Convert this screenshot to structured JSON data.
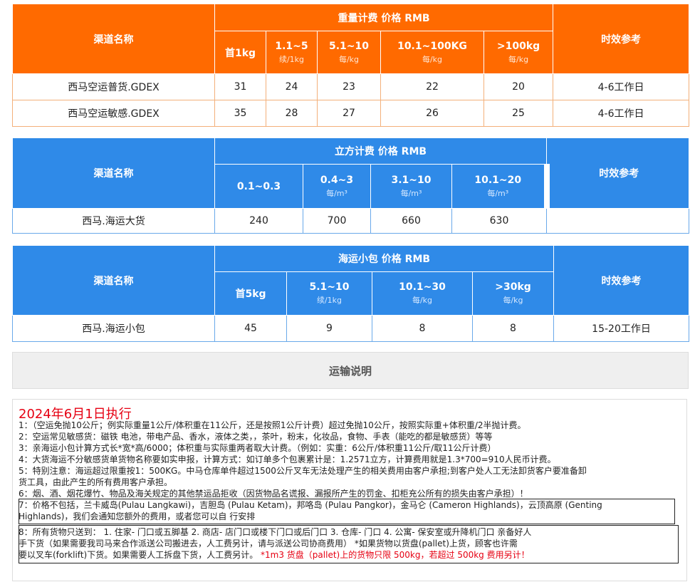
{
  "air": {
    "col_channel": "渠道名称",
    "group_title": "重量计费 价格 RMB",
    "col_time": "时效参考",
    "cols": [
      {
        "label": "首1kg",
        "sub": ""
      },
      {
        "label": "1.1~5",
        "sub": "续/1kg"
      },
      {
        "label": "5.1~10",
        "sub": "每/kg"
      },
      {
        "label": "10.1~100KG",
        "sub": "每/kg"
      },
      {
        "label": ">100kg",
        "sub": "每/kg"
      }
    ],
    "rows": [
      {
        "name": "西马空运普货.GDEX",
        "values": [
          "31",
          "24",
          "23",
          "22",
          "20"
        ],
        "time": "4-6工作日"
      },
      {
        "name": "西马空运敏感.GDEX",
        "values": [
          "35",
          "28",
          "27",
          "26",
          "25"
        ],
        "time": "4-6工作日"
      }
    ]
  },
  "sea_cube": {
    "col_channel": "渠道名称",
    "group_title": "立方计费 价格 RMB",
    "col_time": "时效参考",
    "cols": [
      {
        "label": "0.1~0.3",
        "sub": ""
      },
      {
        "label": "0.4~3",
        "sub": "每/m³"
      },
      {
        "label": "3.1~10",
        "sub": "每/m³"
      },
      {
        "label": "10.1~20",
        "sub": "每/m³"
      }
    ],
    "rows": [
      {
        "name": "西马.海运大货",
        "values": [
          "240",
          "700",
          "660",
          "630"
        ],
        "time": ""
      }
    ]
  },
  "sea_small": {
    "col_channel": "渠道名称",
    "group_title": "海运小包 价格 RMB",
    "col_time": "时效参考",
    "cols": [
      {
        "label": "首5kg",
        "sub": ""
      },
      {
        "label": "5.1~10",
        "sub": "续/1kg"
      },
      {
        "label": "10.1~30",
        "sub": "每/kg"
      },
      {
        "label": ">30kg",
        "sub": "每/kg"
      }
    ],
    "rows": [
      {
        "name": "西马.海运小包",
        "values": [
          "45",
          "9",
          "8",
          "8"
        ],
        "time": "15-20工作日"
      }
    ]
  },
  "notes": {
    "button": "运输说明",
    "title": "2024年6月1日执行",
    "l1": "1：（空运免抛10公斤；例实际重量1公斤/体积重在11公斤，还是按照1公斤计费）超过免抛10公斤，按照实际重+体积重/2半抛计费。",
    "l2": "2：空运常见敏感货：磁铁 电池，带电产品、香水，液体之类，，茶叶，粉末，化妆品，食物、手表（能吃的都是敏感货）等等",
    "l3": "3：亲海运小包计算方式长*宽*高/6000；体积重与实际重两者取大计费。（例如：实重：6公斤/体积重11公斤/取11公斤计费）",
    "l4": "4：大货海运不分敏感货单货物名称要如实申报，计算方式：如订单多个包裹累计是：1.2571立方，计算费用就是1.3*700=910人民币计费。",
    "l5a": "5：特别注意：海运超过限重按1：500KG。中马仓库单件超过1500公斤叉车无法处理产生的相关费用由客户承担;到客户处人工无法卸货客户要准备卸",
    "l5b": "货工具，由此产生的所有费用客户承担。",
    "l6": "6：烟、酒、烟花爆竹、物品及海关规定的其他禁运品拒收（因货物品名谎报、漏报所产生的罚金、扣柜充公所有的损失由客户承担）！",
    "l7a": "7：价格不包括，兰卡威岛(Pulau Langkawi)，吉胆岛 (Pulau Ketam)，邦咯岛 (Pulau Pangkor)，金马仑 (Cameron Highlands)，云顶高原 (Genting",
    "l7b": "Highlands)，我们会通知您额外的费用，或者您可以自 行安排",
    "l8a": "8：所有货物只送到： 1. 住家- 门口或五脚基 2. 商店- 店门口或楼下门口或后门口 3. 仓库- 门口 4. 公寓- 保安室或升降机门口 亲备好人",
    "l8b": "手下货（如果需要我司马来合作派送公司搬进去，人工费另计，请与派送公司协商费用） *如果货物以货盘(pallet)上货，顾客也许需",
    "l8c": "要以叉车(forklift)下货。如果需要人工拆盘下货，人工费另计。",
    "l8d": "*1m3 货盘（pallet)上的货物只限 500kg，若超过 500kg 费用另计！"
  }
}
